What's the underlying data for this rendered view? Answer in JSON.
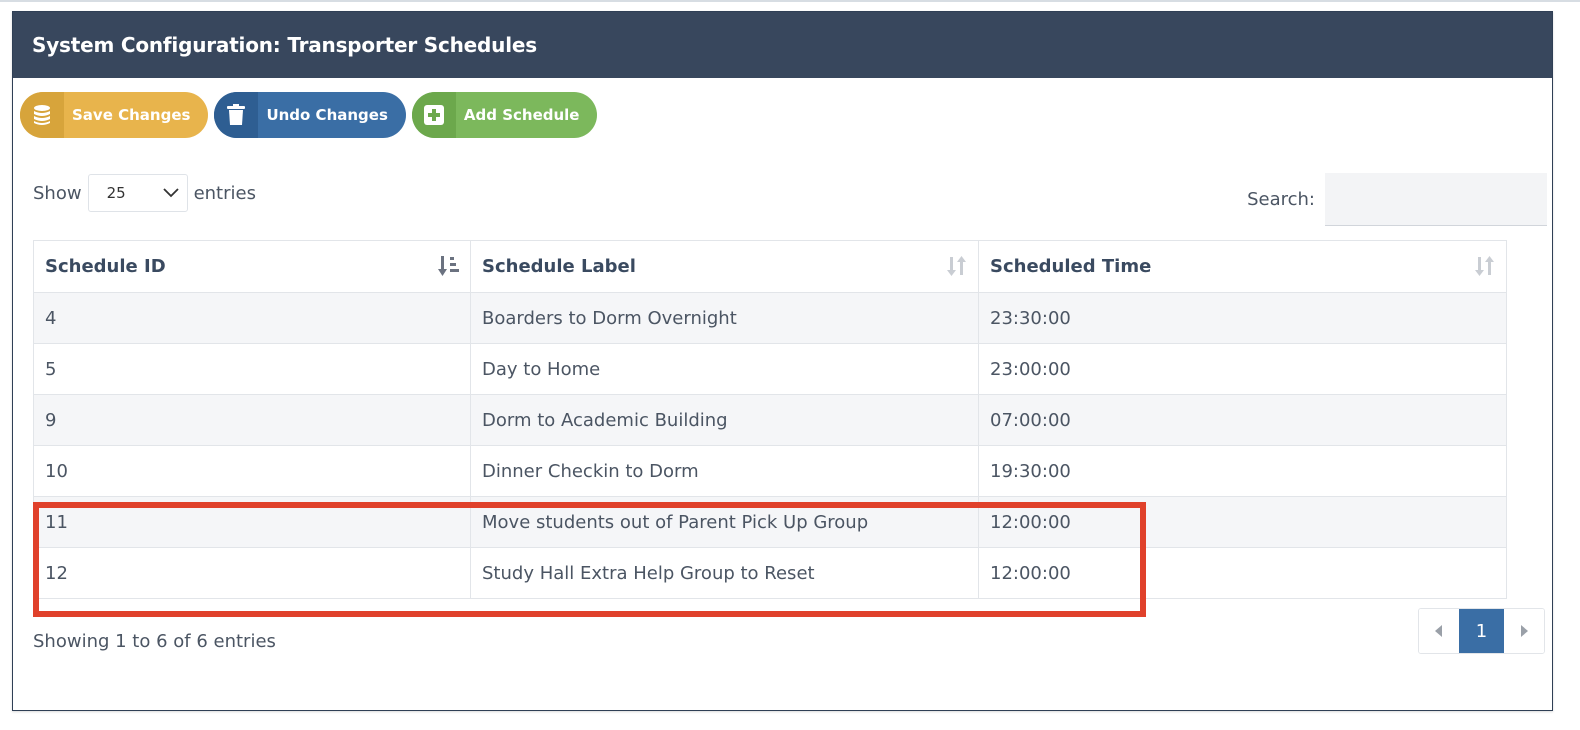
{
  "panel": {
    "title": "System Configuration: Transporter Schedules"
  },
  "toolbar": {
    "save_label": "Save Changes",
    "undo_label": "Undo Changes",
    "add_label": "Add Schedule"
  },
  "length": {
    "show_label": "Show",
    "value": "25",
    "entries_label": "entries"
  },
  "search": {
    "label": "Search:",
    "value": ""
  },
  "table": {
    "headers": [
      "Schedule ID",
      "Schedule Label",
      "Scheduled Time"
    ],
    "rows": [
      [
        "4",
        "Boarders to Dorm Overnight",
        "23:30:00"
      ],
      [
        "5",
        "Day to Home",
        "23:00:00"
      ],
      [
        "9",
        "Dorm to Academic Building",
        "07:00:00"
      ],
      [
        "10",
        "Dinner Checkin to Dorm",
        "19:30:00"
      ],
      [
        "11",
        "Move students out of Parent Pick Up Group",
        "12:00:00"
      ],
      [
        "12",
        "Study Hall Extra Help Group to Reset",
        "12:00:00"
      ]
    ]
  },
  "info": "Showing 1 to 6 of 6 entries",
  "pagination": {
    "current": "1"
  },
  "colors": {
    "header_bg": "#38475d",
    "save": "#e8b44c",
    "undo": "#3a6ea5",
    "add": "#7cb85c",
    "highlight": "#e0412b"
  }
}
